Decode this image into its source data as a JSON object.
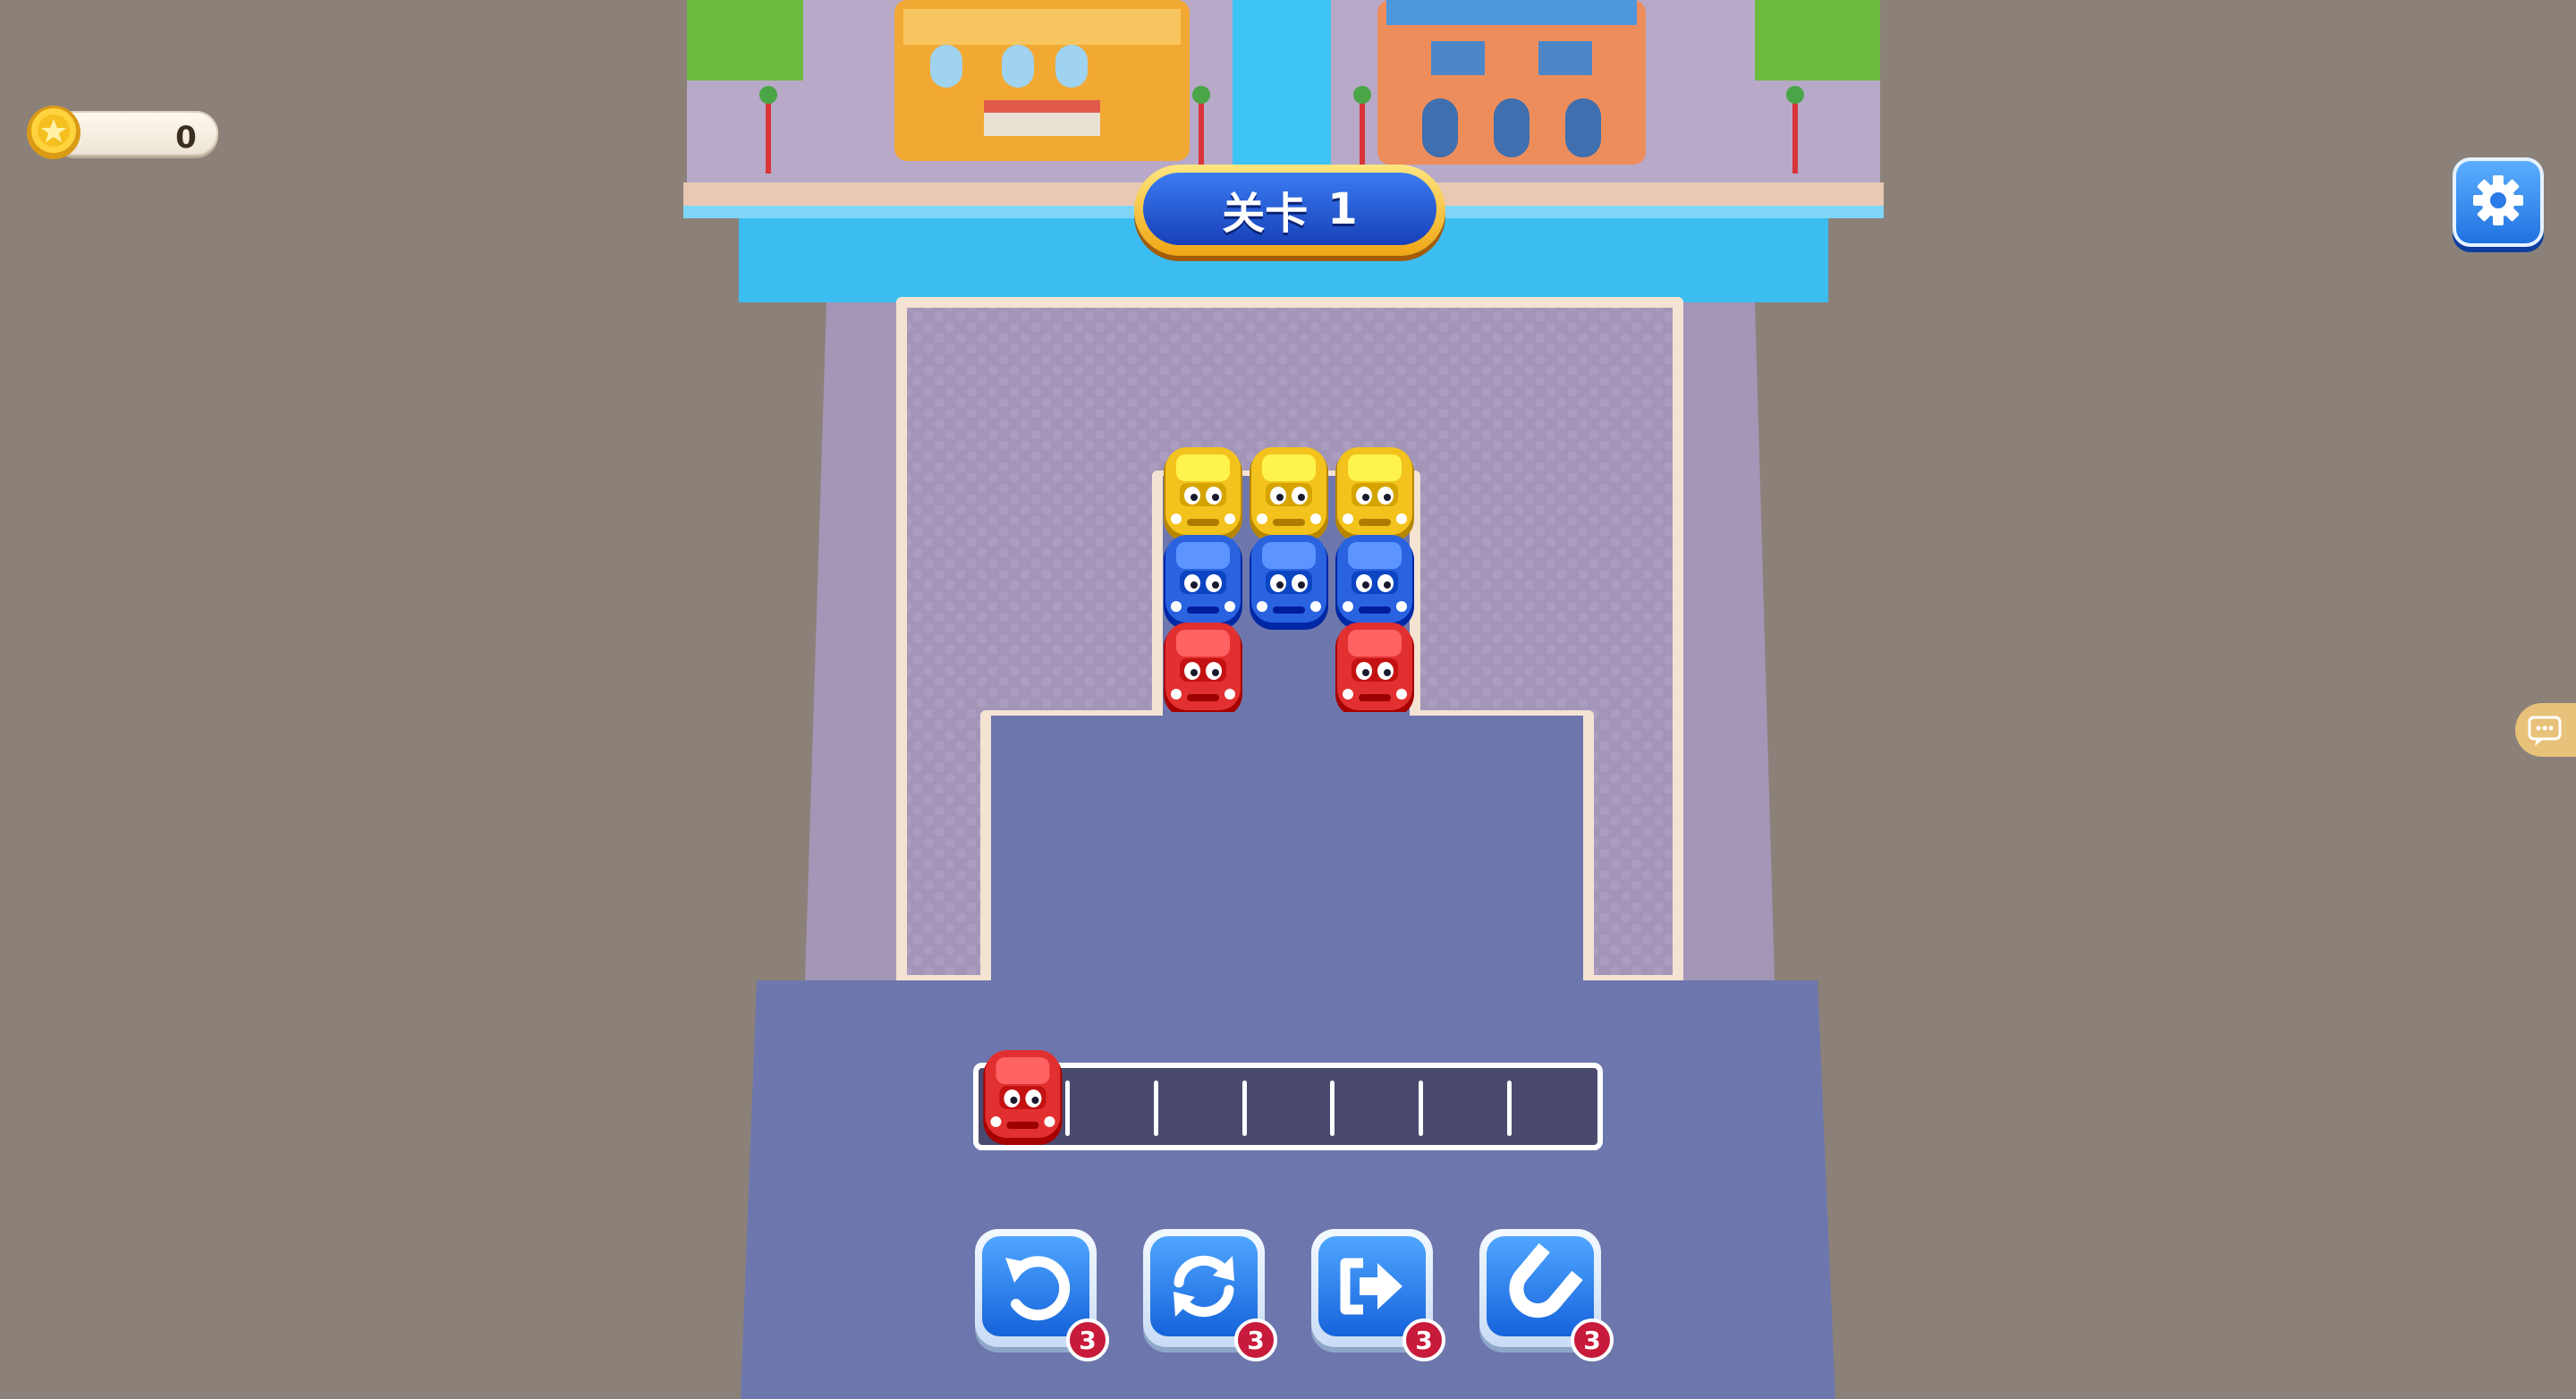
{
  "hud": {
    "coins": "0",
    "level_label": "关卡",
    "level_number": "1"
  },
  "tools": [
    {
      "name": "undo",
      "count": "3"
    },
    {
      "name": "shuffle",
      "count": "3"
    },
    {
      "name": "move-out",
      "count": "3"
    },
    {
      "name": "magnet",
      "count": "3"
    }
  ],
  "slots": {
    "capacity": 7,
    "filled": [
      "red"
    ]
  },
  "car_grid": [
    [
      "yellow",
      "yellow",
      "yellow"
    ],
    [
      "blue",
      "blue",
      "blue"
    ],
    [
      "red",
      "",
      "red"
    ]
  ],
  "colors": {
    "red": "#e23030",
    "blue": "#2a63e0",
    "yellow": "#f3c21c",
    "road": "#6d77ad",
    "parking": "#9d8fb0",
    "water": "#38b8f2",
    "accent": "#1f6ee6"
  }
}
